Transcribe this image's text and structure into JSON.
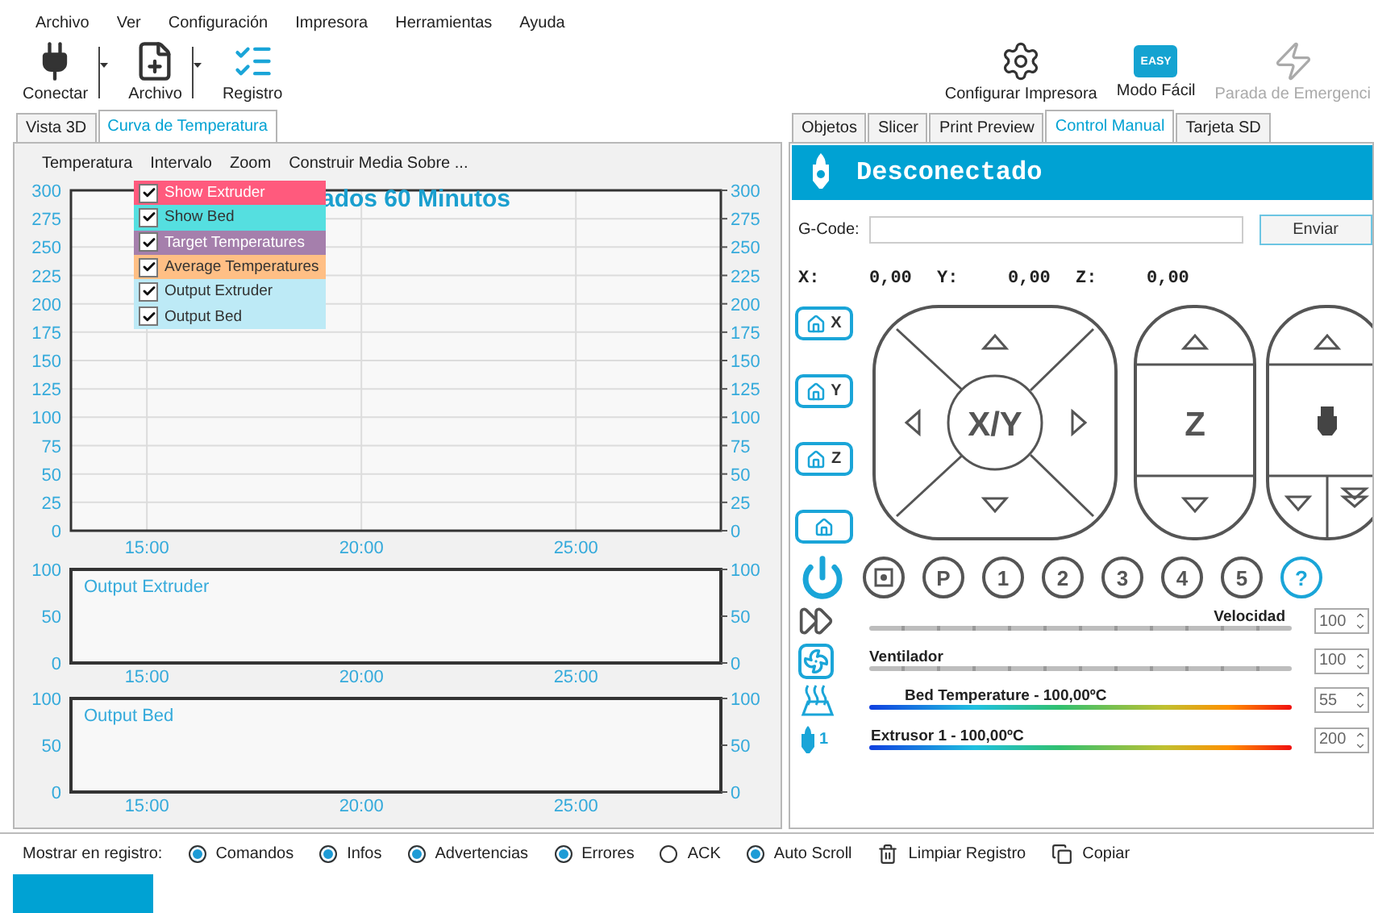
{
  "menu": [
    "Archivo",
    "Ver",
    "Configuración",
    "Impresora",
    "Herramientas",
    "Ayuda"
  ],
  "toolbar_left": [
    {
      "label": "Conectar",
      "dropdown": true
    },
    {
      "label": "Archivo",
      "dropdown": true
    },
    {
      "label": "Registro",
      "dropdown": false
    }
  ],
  "toolbar_right": [
    {
      "label": "Configurar Impresora",
      "disabled": false
    },
    {
      "label": "Modo Fácil",
      "badge": "EASY",
      "disabled": false
    },
    {
      "label": "Parada de Emergenci",
      "disabled": true
    }
  ],
  "left_tabs": [
    {
      "label": "Vista 3D",
      "selected": false
    },
    {
      "label": "Curva de Temperatura",
      "selected": true
    }
  ],
  "chart_menu": [
    "Temperatura",
    "Intervalo",
    "Zoom",
    "Construir Media Sobre ..."
  ],
  "legend": [
    {
      "label": "Show Extruder",
      "checked": true,
      "color": "#ff5a7d"
    },
    {
      "label": "Show Bed",
      "checked": true,
      "color": "#55dfe0"
    },
    {
      "label": "Target Temperatures",
      "checked": true,
      "color": "#a57fac"
    },
    {
      "label": "Average Temperatures",
      "checked": true,
      "color": "#ffbf85"
    },
    {
      "label": "Output Extruder",
      "checked": true,
      "color": "#bdeaf6"
    },
    {
      "label": "Output Bed",
      "checked": true,
      "color": "#bdeaf6"
    }
  ],
  "charts": [
    {
      "chart_data": {
        "type": "line",
        "title": "ados 60 Minutos",
        "grid": true,
        "xlim": [
          13.23,
          28.38
        ],
        "ylim": [
          0,
          300
        ],
        "xticks": [
          {
            "value": 15,
            "label": "15:00"
          },
          {
            "value": 20,
            "label": "20:00"
          },
          {
            "value": 25,
            "label": "25:00"
          }
        ],
        "yticks": [
          0,
          25,
          50,
          75,
          100,
          125,
          150,
          175,
          200,
          225,
          250,
          275,
          300
        ]
      },
      "left_axis_labels": [
        "300",
        "275",
        "250",
        "225",
        "200",
        "175",
        "150",
        "125",
        "100",
        "75",
        "50",
        "25",
        "0"
      ],
      "right_axis_labels": [
        "300",
        "275",
        "250",
        "225",
        "200",
        "175",
        "150",
        "125",
        "100",
        "75",
        "50",
        "25",
        "0"
      ]
    },
    {
      "chart_data": {
        "type": "line",
        "title": "Output Extruder",
        "xlim": [
          13.23,
          28.38
        ],
        "ylim": [
          0,
          100
        ],
        "xticks": [
          {
            "value": 15,
            "label": "15:00"
          },
          {
            "value": 20,
            "label": "20:00"
          },
          {
            "value": 25,
            "label": "25:00"
          }
        ],
        "yticks": [
          0,
          50,
          100
        ]
      },
      "left_axis_labels": [
        "100",
        "50",
        "0"
      ],
      "right_axis_labels": [
        "100",
        "50",
        "0"
      ]
    },
    {
      "chart_data": {
        "type": "line",
        "title": "Output Bed",
        "xlim": [
          13.23,
          28.38
        ],
        "ylim": [
          0,
          100
        ],
        "xticks": [
          {
            "value": 15,
            "label": "15:00"
          },
          {
            "value": 20,
            "label": "20:00"
          },
          {
            "value": 25,
            "label": "25:00"
          }
        ],
        "yticks": [
          0,
          50,
          100
        ]
      },
      "left_axis_labels": [
        "100",
        "50",
        "0"
      ],
      "right_axis_labels": [
        "100",
        "50",
        "0"
      ]
    }
  ],
  "right_tabs": [
    {
      "label": "Objetos",
      "selected": false
    },
    {
      "label": "Slicer",
      "selected": false
    },
    {
      "label": "Print Preview",
      "selected": false
    },
    {
      "label": "Control Manual",
      "selected": true
    },
    {
      "label": "Tarjeta SD",
      "selected": false
    }
  ],
  "status": "Desconectado",
  "gcode": {
    "label": "G-Code:",
    "button": "Enviar"
  },
  "position": [
    {
      "axis": "X:",
      "value": "0,00"
    },
    {
      "axis": "Y:",
      "value": "0,00"
    },
    {
      "axis": "Z:",
      "value": "0,00"
    }
  ],
  "home_buttons": [
    "X",
    "Y",
    "Z"
  ],
  "jog": {
    "xy_label": "X/Y",
    "z_label": "Z"
  },
  "preset_buttons": [
    "P",
    "1",
    "2",
    "3",
    "4",
    "5"
  ],
  "help": "?",
  "sliders": [
    {
      "kind": "plain",
      "label": "Velocidad",
      "value": "100",
      "level": 1
    },
    {
      "kind": "plain",
      "label": "Ventilador",
      "value": "100",
      "level": 1
    },
    {
      "kind": "gradient",
      "label": "Bed Temperature - 100,00ºC",
      "value": "55",
      "level": 1
    },
    {
      "kind": "gradient",
      "icon_label": "1",
      "label": "Extrusor 1 - 100,00ºC",
      "value": "200",
      "level": 1
    }
  ],
  "log": {
    "label": "Mostrar en registro:",
    "options": [
      {
        "label": "Comandos",
        "checked": true
      },
      {
        "label": "Infos",
        "checked": true
      },
      {
        "label": "Advertencias",
        "checked": true
      },
      {
        "label": "Errores",
        "checked": true
      },
      {
        "label": "ACK",
        "checked": false
      },
      {
        "label": "Auto Scroll",
        "checked": true
      }
    ],
    "actions": [
      "Limpiar Registro",
      "Copiar"
    ]
  }
}
